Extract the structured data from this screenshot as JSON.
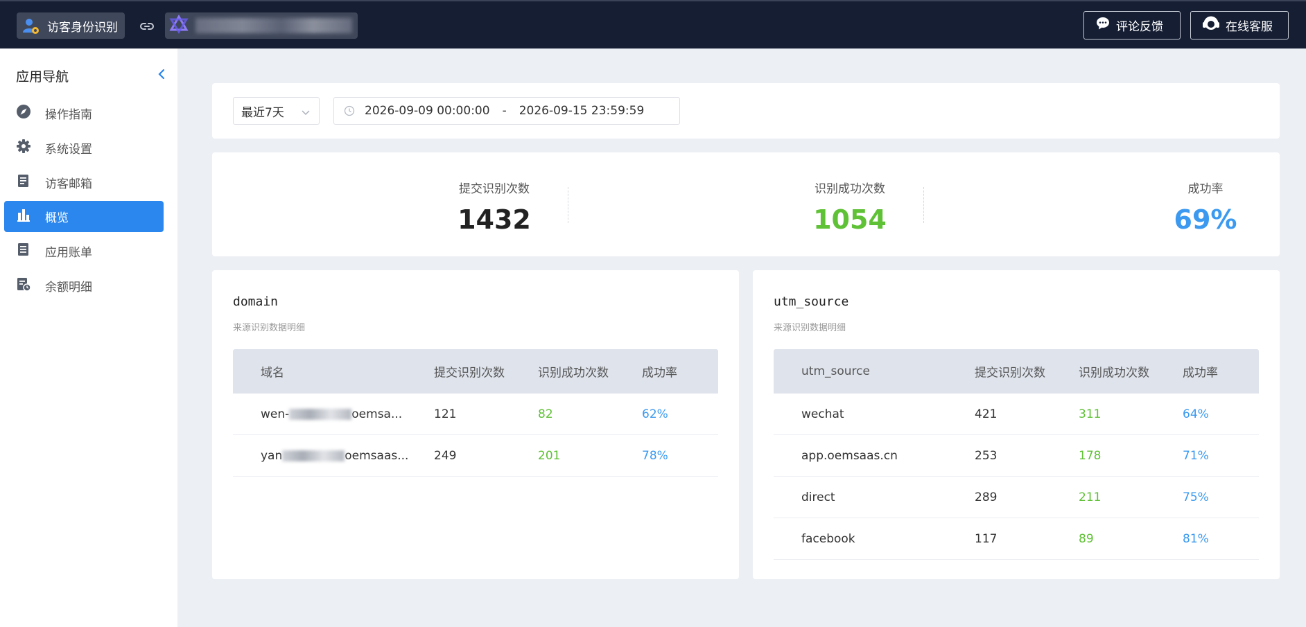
{
  "header": {
    "app_name": "访客身份识别",
    "feedback_label": "评论反馈",
    "service_label": "在线客服"
  },
  "sidebar": {
    "title": "应用导航",
    "items": [
      {
        "label": "操作指南",
        "icon": "compass-icon"
      },
      {
        "label": "系统设置",
        "icon": "gear-icon"
      },
      {
        "label": "访客邮箱",
        "icon": "document-icon"
      },
      {
        "label": "概览",
        "icon": "bar-chart-icon",
        "active": true
      },
      {
        "label": "应用账单",
        "icon": "bill-icon"
      },
      {
        "label": "余额明细",
        "icon": "balance-icon"
      }
    ]
  },
  "filter": {
    "range_select": "最近7天",
    "start": "2026-09-09 00:00:00",
    "separator": "-",
    "end": "2026-09-15 23:59:59"
  },
  "stats": [
    {
      "label": "提交识别次数",
      "value": "1432",
      "color": "#222222"
    },
    {
      "label": "识别成功次数",
      "value": "1054",
      "color": "#5fc135"
    },
    {
      "label": "成功率",
      "value": "69%",
      "color": "#3b9af0"
    }
  ],
  "domain_table": {
    "title": "domain",
    "subtitle": "来源识别数据明细",
    "columns": [
      "域名",
      "提交识别次数",
      "识别成功次数",
      "成功率"
    ],
    "rows": [
      {
        "prefix": "wen-",
        "suffix": "oemsa...",
        "submitted": "121",
        "success": "82",
        "rate": "62%"
      },
      {
        "prefix": "yan",
        "suffix": "oemsaas...",
        "submitted": "249",
        "success": "201",
        "rate": "78%"
      }
    ]
  },
  "utm_table": {
    "title": "utm_source",
    "subtitle": "来源识别数据明细",
    "columns": [
      "utm_source",
      "提交识别次数",
      "识别成功次数",
      "成功率"
    ],
    "rows": [
      {
        "source": "wechat",
        "submitted": "421",
        "success": "311",
        "rate": "64%"
      },
      {
        "source": "app.oemsaas.cn",
        "submitted": "253",
        "success": "178",
        "rate": "71%"
      },
      {
        "source": "direct",
        "submitted": "289",
        "success": "211",
        "rate": "75%"
      },
      {
        "source": "facebook",
        "submitted": "117",
        "success": "89",
        "rate": "81%"
      }
    ]
  },
  "colors": {
    "header_bg": "#151e33",
    "accent": "#2b86ee",
    "success": "#5fc135",
    "rate": "#3b9af0"
  }
}
